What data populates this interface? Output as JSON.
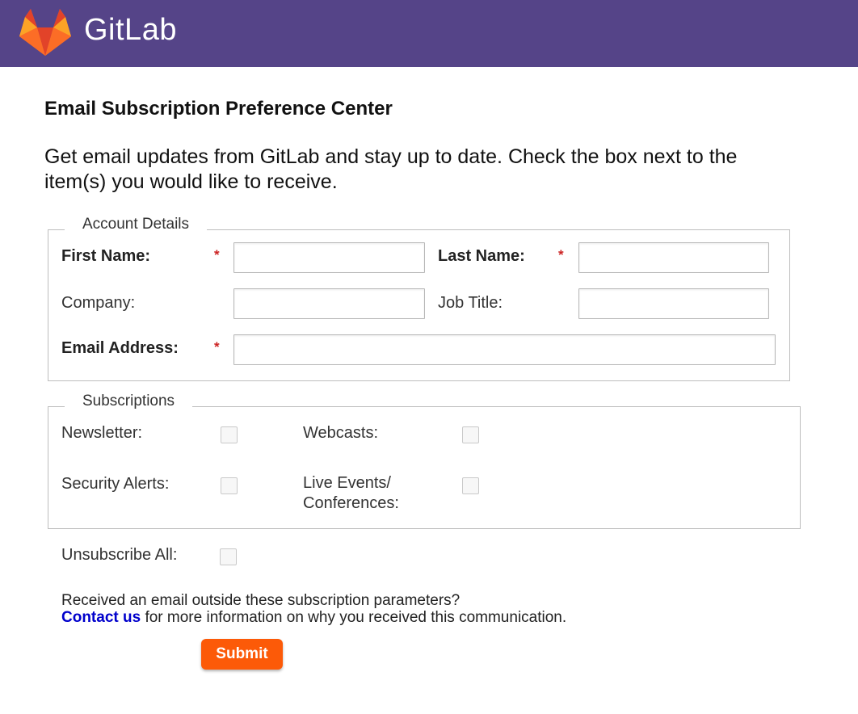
{
  "header": {
    "brand_name": "GitLab",
    "background_color": "#554488",
    "logo_icon": "gitlab-fox-icon"
  },
  "page": {
    "heading": "Email Subscription Preference Center",
    "intro": "Get email updates from GitLab and stay up to date. Check the box next to the item(s) you would like to receive."
  },
  "account": {
    "legend": "Account Details",
    "required_marker": "*",
    "first_name": {
      "label": "First Name:",
      "value": ""
    },
    "last_name": {
      "label": "Last Name:",
      "value": ""
    },
    "company": {
      "label": "Company:",
      "value": ""
    },
    "job_title": {
      "label": "Job Title:",
      "value": ""
    },
    "email": {
      "label": "Email Address:",
      "value": ""
    }
  },
  "subscriptions": {
    "legend": "Subscriptions",
    "newsletter": {
      "label": "Newsletter:",
      "checked": false
    },
    "webcasts": {
      "label": "Webcasts:",
      "checked": false
    },
    "security_alerts": {
      "label": "Security Alerts:",
      "checked": false
    },
    "live_events": {
      "label_line1": "Live Events/",
      "label_line2": "Conferences:",
      "checked": false
    }
  },
  "unsubscribe": {
    "label": "Unsubscribe All:",
    "checked": false
  },
  "note": {
    "line1": "Received an email outside these subscription parameters?",
    "link_text": "Contact us",
    "line2_rest": " for more information on why you received this communication."
  },
  "submit_label": "Submit",
  "colors": {
    "accent": "#fc5a08",
    "link": "#0000cc",
    "required": "#cc2222"
  }
}
